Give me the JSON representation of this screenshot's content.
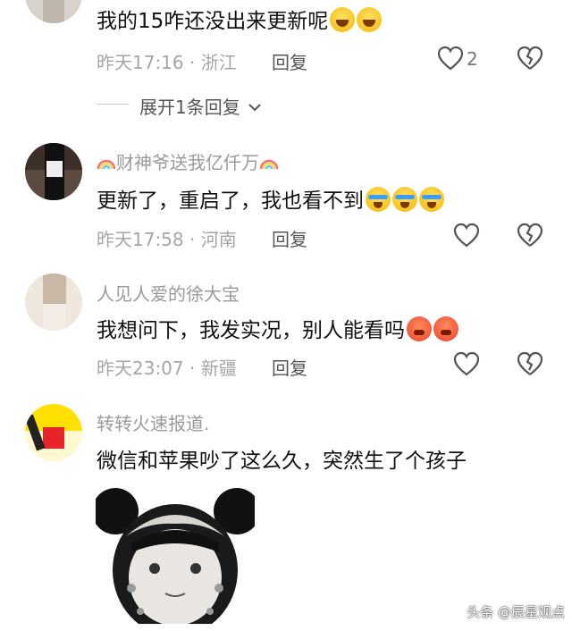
{
  "comments": [
    {
      "text": "我的15咋还没出来更新呢",
      "emojis": [
        "laugh-cry-emoji",
        "laugh-cry-emoji"
      ],
      "time": "昨天17:16 · 浙江",
      "reply_label": "回复",
      "like_count": "2",
      "expand_label": "展开1条回复"
    },
    {
      "username": "财神爷送我亿仟万",
      "text": "更新了，重启了，我也看不到",
      "emojis": [
        "crying-emoji",
        "crying-emoji",
        "crying-emoji"
      ],
      "time": "昨天17:58 · 河南",
      "reply_label": "回复"
    },
    {
      "username": "人见人爱的徐大宝",
      "text": "我想问下，我发实况，别人能看吗",
      "emojis": [
        "red-face-emoji",
        "red-face-emoji"
      ],
      "time": "昨天23:07 · 新疆",
      "reply_label": "回复"
    },
    {
      "username": "转转火速报道.",
      "text": "微信和苹果吵了这么久，突然生了个孩子"
    }
  ],
  "icons": [
    "heart-icon",
    "heart-broken-icon",
    "chevron-down-icon",
    "rainbow-icon"
  ],
  "colors": {
    "meta_gray": "#a5a5a5",
    "name_gray": "#9a9a9a",
    "text": "#111111"
  },
  "watermark": "头条 @辰星观点"
}
